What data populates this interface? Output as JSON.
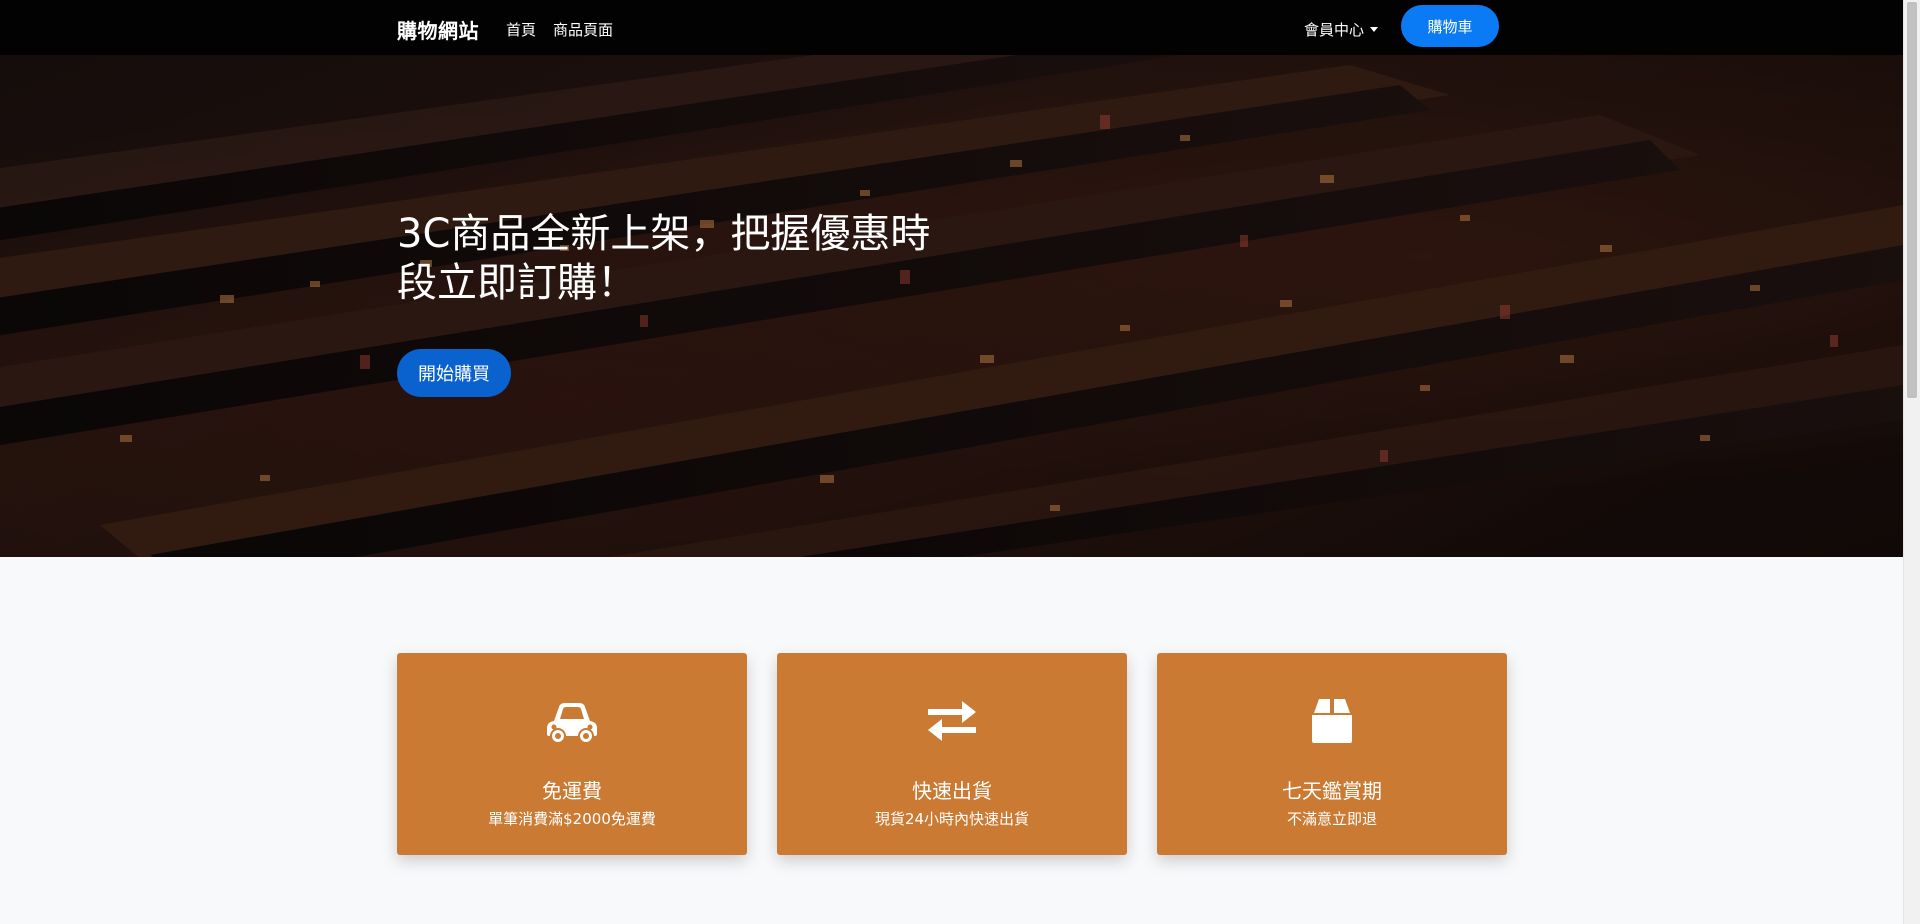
{
  "navbar": {
    "brand": "購物網站",
    "links": [
      {
        "label": "首頁"
      },
      {
        "label": "商品頁面"
      }
    ],
    "member_menu": "會員中心",
    "cart_button": "購物車"
  },
  "hero": {
    "title": "3C商品全新上架，把握優惠時段立即訂購！",
    "cta": "開始購買"
  },
  "features": [
    {
      "icon": "car-icon",
      "title": "免運費",
      "desc": "單筆消費滿$2000免運費"
    },
    {
      "icon": "exchange-arrows-icon",
      "title": "快速出貨",
      "desc": "現貨24小時內快速出貨"
    },
    {
      "icon": "box-icon",
      "title": "七天鑑賞期",
      "desc": "不滿意立即退"
    }
  ],
  "colors": {
    "navbar_bg": "#020202",
    "primary": "#0a7bf5",
    "card_bg": "#ca7a32",
    "page_bg": "#f8f9fb"
  }
}
